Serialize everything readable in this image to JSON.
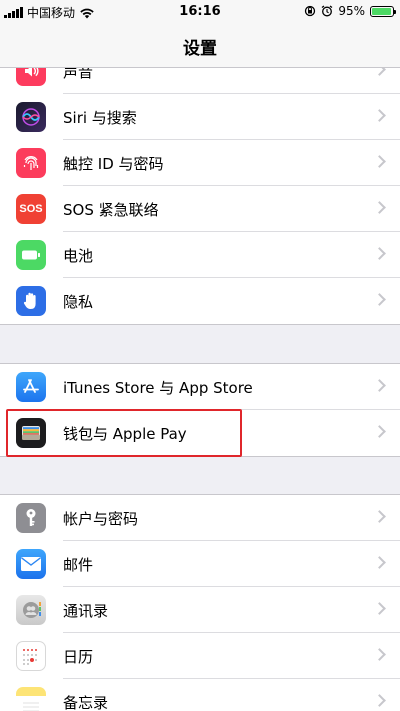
{
  "status_bar": {
    "carrier": "中国移动",
    "time": "16:16",
    "battery": "95%",
    "battery_level": 0.95
  },
  "nav": {
    "title": "设置"
  },
  "groups": [
    {
      "items": [
        {
          "label": "声音",
          "icon": "speaker-icon",
          "color": "#fd3b5e"
        },
        {
          "label": "Siri 与搜索",
          "icon": "siri-icon",
          "color": "#1d1d3a"
        },
        {
          "label": "触控 ID 与密码",
          "icon": "fingerprint-icon",
          "color": "#fc3c5c"
        },
        {
          "label": "SOS 紧急联络",
          "icon": "sos-icon",
          "color": "#f04134",
          "icon_text": "SOS"
        },
        {
          "label": "电池",
          "icon": "battery-icon",
          "color": "#4cd964"
        },
        {
          "label": "隐私",
          "icon": "hand-icon",
          "color": "#2d6ee6"
        }
      ]
    },
    {
      "items": [
        {
          "label": "iTunes Store 与 App Store",
          "icon": "app-store-icon",
          "color": "#2f8cf6"
        },
        {
          "label": "钱包与 Apple Pay",
          "icon": "wallet-icon",
          "color": "#1c1c1e"
        }
      ]
    },
    {
      "items": [
        {
          "label": "帐户与密码",
          "icon": "key-icon",
          "color": "#8e8e93"
        },
        {
          "label": "邮件",
          "icon": "mail-icon",
          "color": "#2e8ff5"
        },
        {
          "label": "通讯录",
          "icon": "contacts-icon",
          "color": "#d3d3d3"
        },
        {
          "label": "日历",
          "icon": "calendar-icon",
          "color": "#ffffff"
        },
        {
          "label": "备忘录",
          "icon": "notes-icon",
          "color": "#fdd94b"
        }
      ]
    }
  ]
}
